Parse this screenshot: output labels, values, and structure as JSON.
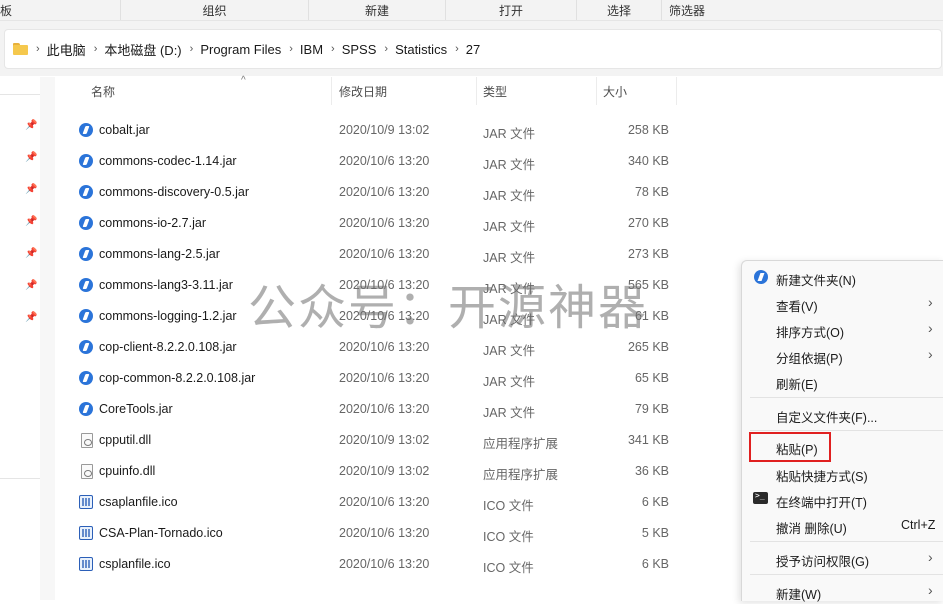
{
  "ribbon": [
    "板",
    "组织",
    "新建",
    "打开",
    "选择",
    "筛选器"
  ],
  "breadcrumb": [
    "此电脑",
    "本地磁盘 (D:)",
    "Program Files",
    "IBM",
    "SPSS",
    "Statistics",
    "27"
  ],
  "columns": {
    "name": "名称",
    "date": "修改日期",
    "type": "类型",
    "size": "大小"
  },
  "files": [
    {
      "name": "cobalt.jar",
      "date": "2020/10/9 13:02",
      "type": "JAR 文件",
      "size": "258 KB",
      "icon": "jar"
    },
    {
      "name": "commons-codec-1.14.jar",
      "date": "2020/10/6 13:20",
      "type": "JAR 文件",
      "size": "340 KB",
      "icon": "jar"
    },
    {
      "name": "commons-discovery-0.5.jar",
      "date": "2020/10/6 13:20",
      "type": "JAR 文件",
      "size": "78 KB",
      "icon": "jar"
    },
    {
      "name": "commons-io-2.7.jar",
      "date": "2020/10/6 13:20",
      "type": "JAR 文件",
      "size": "270 KB",
      "icon": "jar"
    },
    {
      "name": "commons-lang-2.5.jar",
      "date": "2020/10/6 13:20",
      "type": "JAR 文件",
      "size": "273 KB",
      "icon": "jar"
    },
    {
      "name": "commons-lang3-3.11.jar",
      "date": "2020/10/6 13:20",
      "type": "JAR 文件",
      "size": "565 KB",
      "icon": "jar"
    },
    {
      "name": "commons-logging-1.2.jar",
      "date": "2020/10/6 13:20",
      "type": "JAR 文件",
      "size": "61 KB",
      "icon": "jar"
    },
    {
      "name": "cop-client-8.2.2.0.108.jar",
      "date": "2020/10/6 13:20",
      "type": "JAR 文件",
      "size": "265 KB",
      "icon": "jar"
    },
    {
      "name": "cop-common-8.2.2.0.108.jar",
      "date": "2020/10/6 13:20",
      "type": "JAR 文件",
      "size": "65 KB",
      "icon": "jar"
    },
    {
      "name": "CoreTools.jar",
      "date": "2020/10/6 13:20",
      "type": "JAR 文件",
      "size": "79 KB",
      "icon": "jar"
    },
    {
      "name": "cpputil.dll",
      "date": "2020/10/9 13:02",
      "type": "应用程序扩展",
      "size": "341 KB",
      "icon": "dll"
    },
    {
      "name": "cpuinfo.dll",
      "date": "2020/10/9 13:02",
      "type": "应用程序扩展",
      "size": "36 KB",
      "icon": "dll"
    },
    {
      "name": "csaplanfile.ico",
      "date": "2020/10/6 13:20",
      "type": "ICO 文件",
      "size": "6 KB",
      "icon": "ico"
    },
    {
      "name": "CSA-Plan-Tornado.ico",
      "date": "2020/10/6 13:20",
      "type": "ICO 文件",
      "size": "5 KB",
      "icon": "ico"
    },
    {
      "name": "csplanfile.ico",
      "date": "2020/10/6 13:20",
      "type": "ICO 文件",
      "size": "6 KB",
      "icon": "ico"
    }
  ],
  "context_menu": {
    "new_folder": "新建文件夹(N)",
    "view": "查看(V)",
    "sort": "排序方式(O)",
    "group": "分组依据(P)",
    "refresh": "刷新(E)",
    "customize": "自定义文件夹(F)...",
    "paste": "粘贴(P)",
    "paste_shortcut": "粘贴快捷方式(S)",
    "open_terminal": "在终端中打开(T)",
    "undo_delete": "撤消 删除(U)",
    "undo_shortcut": "Ctrl+Z",
    "give_access": "授予访问权限(G)",
    "new": "新建(W)"
  },
  "watermark": "公众号：开源神器",
  "colors": {
    "accent": "#2b74d9",
    "highlight_border": "#e02020",
    "folder": "#f5c84d"
  }
}
